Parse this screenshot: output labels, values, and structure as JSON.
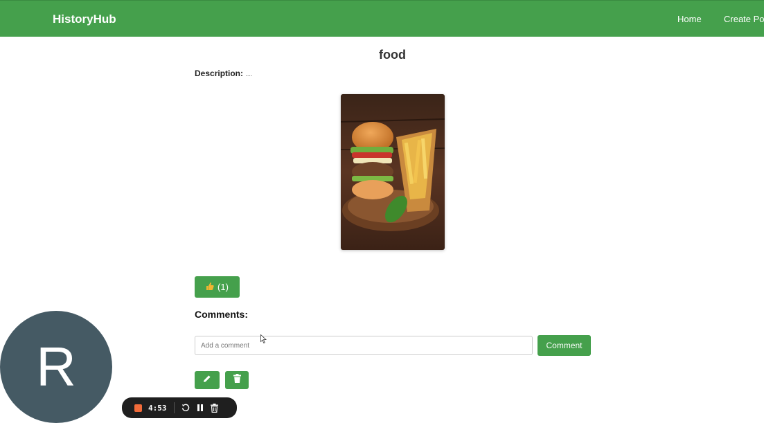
{
  "navbar": {
    "brand": "HistoryHub",
    "links": [
      "Home",
      "Create Pos"
    ]
  },
  "post": {
    "title": "food",
    "description_label": "Description:",
    "description_value": "....",
    "image_alt": "burger with fries on wooden board"
  },
  "like": {
    "icon": "thumbs-up-icon",
    "count_text": "(1)"
  },
  "comments": {
    "heading": "Comments:",
    "input_placeholder": "Add a comment",
    "submit_label": "Comment"
  },
  "actions": {
    "edit_icon": "pencil-icon",
    "delete_icon": "trash-icon"
  },
  "avatar": {
    "initial": "R",
    "color": "#455a64"
  },
  "recorder": {
    "time": "4:53",
    "stop_color": "#f26b3a"
  },
  "colors": {
    "accent": "#45a04c"
  }
}
